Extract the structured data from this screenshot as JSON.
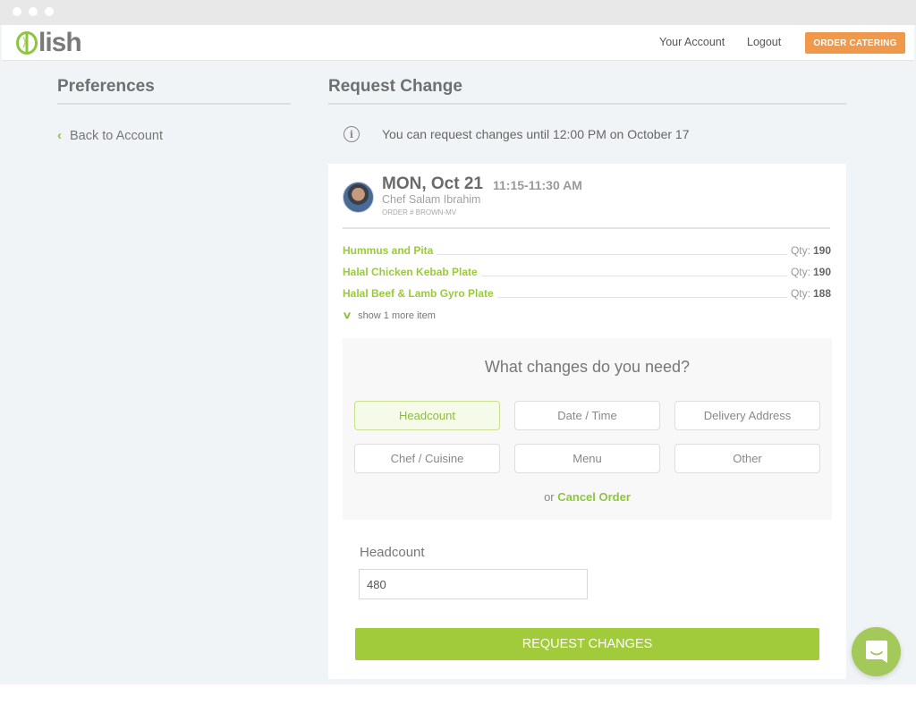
{
  "navbar": {
    "logo_text": "lish",
    "links": [
      {
        "label": "Your Account"
      },
      {
        "label": "Logout"
      }
    ],
    "order_button": "ORDER CATERING",
    "accent_color": "#f0994a"
  },
  "sidebar": {
    "title": "Preferences",
    "back_link": "Back to Account"
  },
  "main": {
    "title": "Request Change",
    "info": "You can request changes until 12:00 PM on October 17",
    "order": {
      "date": "MON, Oct 21",
      "time": "11:15-11:30 AM",
      "chef": "Chef Salam Ibrahim",
      "order_number": "ORDER # BROWN-MV",
      "qty_label": "Qty:",
      "items": [
        {
          "name": "Hummus and Pita",
          "qty": "190"
        },
        {
          "name": "Halal Chicken Kebab Plate",
          "qty": "190"
        },
        {
          "name": "Halal Beef & Lamb Gyro Plate",
          "qty": "188"
        }
      ],
      "show_more": "show 1 more item"
    },
    "changes": {
      "title": "What changes do you need?",
      "options": [
        {
          "label": "Headcount",
          "selected": true
        },
        {
          "label": "Date / Time",
          "selected": false
        },
        {
          "label": "Delivery Address",
          "selected": false
        },
        {
          "label": "Chef / Cuisine",
          "selected": false
        },
        {
          "label": "Menu",
          "selected": false
        },
        {
          "label": "Other",
          "selected": false
        }
      ],
      "or_text": "or",
      "cancel_label": "Cancel Order"
    },
    "headcount": {
      "label": "Headcount",
      "value": "480"
    },
    "submit_label": "REQUEST CHANGES",
    "brand_color": "#a2cb3b"
  }
}
